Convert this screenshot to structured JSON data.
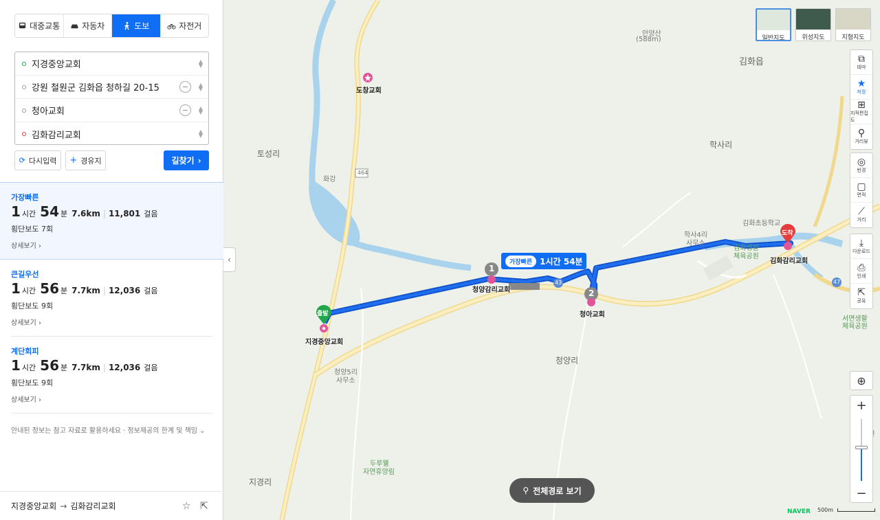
{
  "tabs": [
    {
      "label": "대중교통",
      "icon": "bus-icon",
      "active": false
    },
    {
      "label": "자동차",
      "icon": "car-icon",
      "active": false
    },
    {
      "label": "도보",
      "icon": "walk-icon",
      "active": true
    },
    {
      "label": "자전거",
      "icon": "bicycle-icon",
      "active": false
    }
  ],
  "waypoints": [
    {
      "value": "지경중앙교회",
      "type": "start"
    },
    {
      "value": "강원 철원군 김화읍 청하길 20-15",
      "type": "via"
    },
    {
      "value": "청아교회",
      "type": "via"
    },
    {
      "value": "김화감리교회",
      "type": "end"
    }
  ],
  "actions": {
    "reset": "다시입력",
    "add_via": "경유지",
    "search": "길찾기"
  },
  "routes": [
    {
      "tag": "가장빠른",
      "hours": "1",
      "h_unit": "시간",
      "minutes": "54",
      "m_unit": "분",
      "distance": "7.6km",
      "steps": "11,801",
      "steps_unit": "걸음",
      "crossings": "횡단보도 7회",
      "detail": "상세보기"
    },
    {
      "tag": "큰길우선",
      "hours": "1",
      "h_unit": "시간",
      "minutes": "56",
      "m_unit": "분",
      "distance": "7.7km",
      "steps": "12,036",
      "steps_unit": "걸음",
      "crossings": "횡단보도 9회",
      "detail": "상세보기"
    },
    {
      "tag": "계단회피",
      "hours": "1",
      "h_unit": "시간",
      "minutes": "56",
      "m_unit": "분",
      "distance": "7.7km",
      "steps": "12,036",
      "steps_unit": "걸음",
      "crossings": "횡단보도 9회",
      "detail": "상세보기"
    }
  ],
  "notice": "안내된 정보는 참고 자료로 활용하세요 · 정보제공의 한계 및 책임",
  "footer": {
    "from": "지경중앙교회",
    "arrow": "→",
    "to": "김화감리교회"
  },
  "map_types": [
    {
      "label": "일반지도",
      "active": true
    },
    {
      "label": "위성지도",
      "active": false
    },
    {
      "label": "지형지도",
      "active": false
    }
  ],
  "controls_top": [
    {
      "label": "테마",
      "icon": "theme-icon"
    },
    {
      "label": "저장",
      "icon": "star-icon"
    },
    {
      "label": "지적편집도",
      "icon": "cadastral-icon"
    },
    {
      "label": "거리뷰",
      "icon": "streetview-icon"
    }
  ],
  "controls_mid": [
    {
      "label": "반경",
      "icon": "radius-icon"
    },
    {
      "label": "면적",
      "icon": "area-icon"
    },
    {
      "label": "거리",
      "icon": "ruler-icon"
    }
  ],
  "controls_bot": [
    {
      "label": "다운로드",
      "icon": "download-icon"
    },
    {
      "label": "인쇄",
      "icon": "print-icon"
    },
    {
      "label": "공유",
      "icon": "share-icon"
    }
  ],
  "map_labels": {
    "anyang_mt": "안양산",
    "anyang_alt": "(588m)",
    "gimhwa": "김화읍",
    "dochang": "도창교회",
    "toseong": "토성리",
    "hwagang": "화강",
    "road464": "464",
    "haksa": "학사리",
    "gimhwa_school": "김화초등학교",
    "haksa4": "학사4리",
    "office": "사무소",
    "gimhwa_sports": "김화생활",
    "sports": "체육공원",
    "road43": "43",
    "road47": "47",
    "seomyeon": "서면생활",
    "seomyeon2": "체육공원",
    "cheongyang5": "청양5리",
    "cheongyang5b": "사무소",
    "cheongyang": "청양리",
    "durumi": "두루웰",
    "durumi2": "자연휴양림",
    "jigyeong": "지경리",
    "sucheon": "수천"
  },
  "pins": {
    "start_label": "지경중앙교회",
    "start_badge": "출발",
    "via1_num": "1",
    "via1_label": "청양감리교회",
    "via2_num": "2",
    "via2_label": "청아교회",
    "end_badge": "도착",
    "end_label": "김화감리교회"
  },
  "route_badge": {
    "chip": "가장빠른",
    "time": "1시간 54분"
  },
  "full_route": "전체경로 보기",
  "brand": "NAVER",
  "scale": "500m",
  "colors": {
    "accent": "#0f6ef3",
    "route": "#1864e6",
    "start": "#21a64a",
    "end": "#e43d3d"
  }
}
